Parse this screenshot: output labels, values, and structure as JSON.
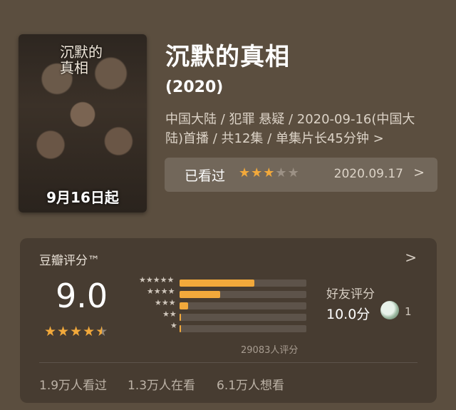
{
  "poster": {
    "title": "沉默的真相",
    "date_label": "9月16日起"
  },
  "header": {
    "title": "沉默的真相",
    "year": "(2020)",
    "meta": "中国大陆 / 犯罪 悬疑 / 2020-09-16(中国大陆)首播 / 共12集 / 单集片长45分钟",
    "meta_chevron": ">"
  },
  "watched": {
    "label": "已看过",
    "stars": 3,
    "max_stars": 5,
    "date": "2020.09.17",
    "chevron": ">"
  },
  "rating": {
    "title": "豆瓣评分™",
    "chevron": ">",
    "score": "9.0",
    "stars": 4.5,
    "distribution": [
      {
        "stars": 5,
        "fraction": 0.59
      },
      {
        "stars": 4,
        "fraction": 0.32
      },
      {
        "stars": 3,
        "fraction": 0.07
      },
      {
        "stars": 2,
        "fraction": 0.01
      },
      {
        "stars": 1,
        "fraction": 0.005
      }
    ],
    "count_label": "29083人评分",
    "friend_label": "好友评分",
    "friend_score": "10.0分",
    "friend_count": "1",
    "stats": [
      "1.9万人看过",
      "1.3万人在看",
      "6.1万人想看"
    ]
  },
  "colors": {
    "accent": "#f2a93b",
    "background": "#5b4e3f"
  }
}
